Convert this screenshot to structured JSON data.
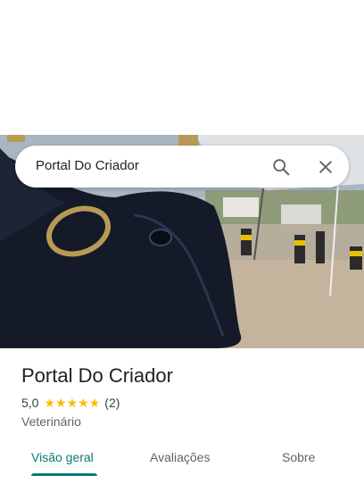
{
  "search": {
    "query": "Portal Do Criador",
    "search_icon": "search-icon",
    "close_icon": "close-icon"
  },
  "hero": {
    "image": "photo of black bull statue"
  },
  "place": {
    "name": "Portal Do Criador",
    "rating": "5,0",
    "stars": 5,
    "review_count": "(2)",
    "category": "Veterinário"
  },
  "tabs": [
    {
      "label": "Visão geral",
      "active": true
    },
    {
      "label": "Avaliações",
      "active": false
    },
    {
      "label": "Sobre",
      "active": false
    }
  ],
  "colors": {
    "accent": "#0b7a75",
    "star": "#fbbc04"
  }
}
